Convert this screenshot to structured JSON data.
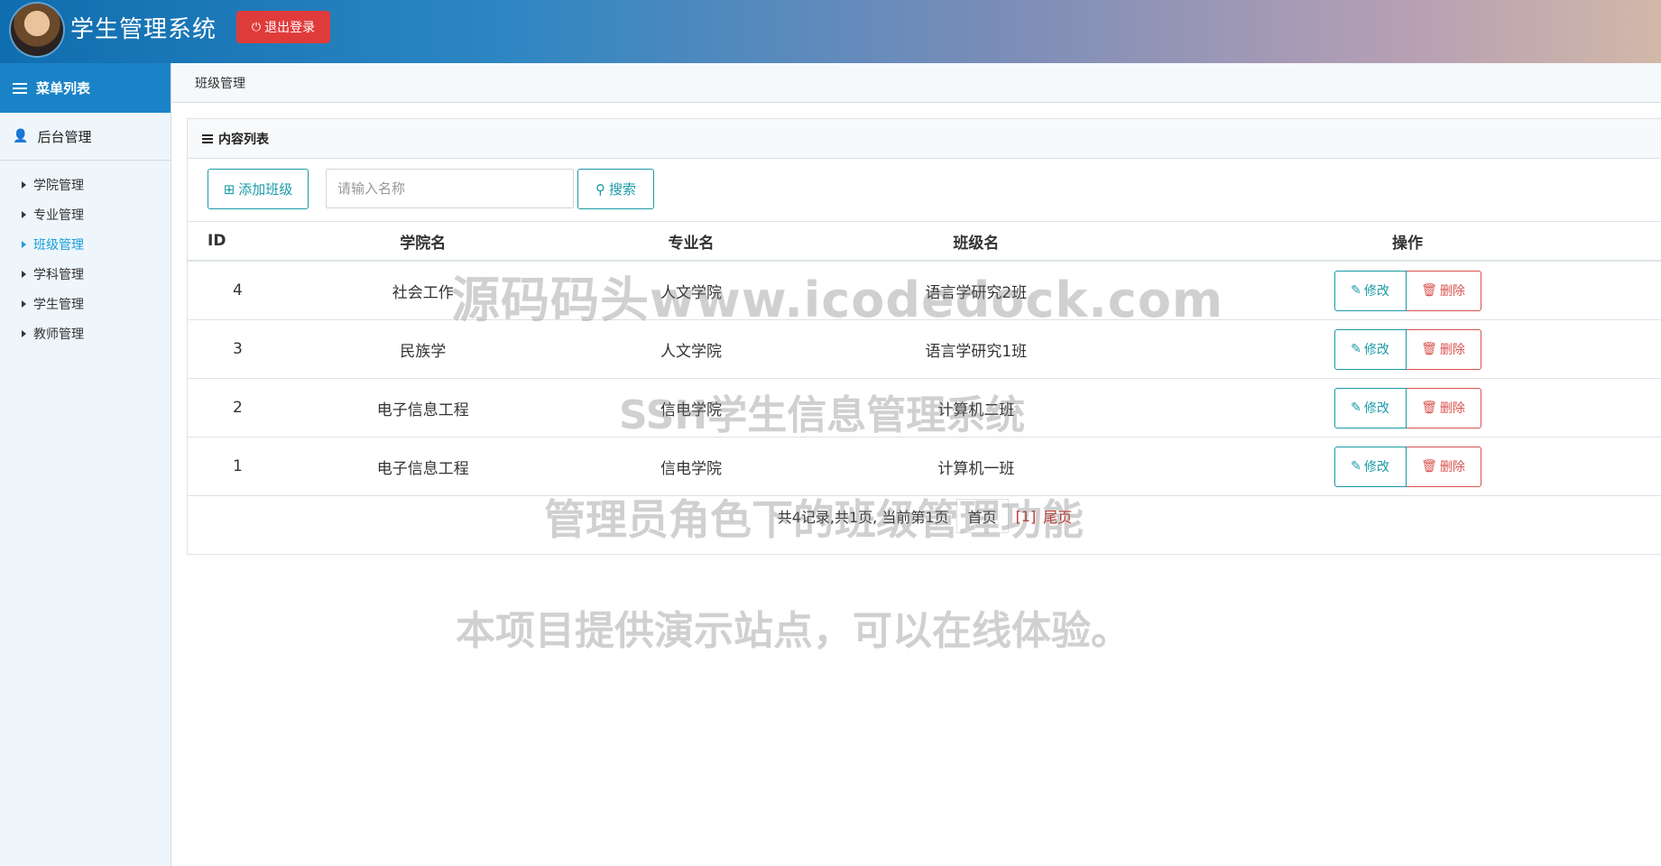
{
  "header": {
    "title": "学生管理系统",
    "logout_label": "退出登录"
  },
  "sidebar": {
    "menu_title": "菜单列表",
    "section_title": "后台管理",
    "items": [
      {
        "label": "学院管理"
      },
      {
        "label": "专业管理"
      },
      {
        "label": "班级管理",
        "active": true
      },
      {
        "label": "学科管理"
      },
      {
        "label": "学生管理"
      },
      {
        "label": "教师管理"
      }
    ]
  },
  "breadcrumb": "班级管理",
  "panel": {
    "title": "内容列表",
    "add_label": "添加班级",
    "search_placeholder": "请输入名称",
    "search_label": "搜索"
  },
  "table": {
    "headers": [
      "ID",
      "学院名",
      "专业名",
      "班级名",
      "操作"
    ],
    "rows": [
      {
        "id": "4",
        "college": "社会工作",
        "major": "人文学院",
        "class": "语言学研究2班"
      },
      {
        "id": "3",
        "college": "民族学",
        "major": "人文学院",
        "class": "语言学研究1班"
      },
      {
        "id": "2",
        "college": "电子信息工程",
        "major": "信电学院",
        "class": "计算机二班"
      },
      {
        "id": "1",
        "college": "电子信息工程",
        "major": "信电学院",
        "class": "计算机一班"
      }
    ],
    "edit_label": "修改",
    "delete_label": "删除"
  },
  "pagination": {
    "summary": "共4记录,共1页, 当前第1页",
    "first": "首页",
    "current": "[1]",
    "last": "尾页"
  },
  "watermark": {
    "line1": "源码码头www.icodedock.com",
    "line2": "SSH学生信息管理系统",
    "line3": "管理员角色下的班级管理功能",
    "line4": "本项目提供演示站点，可以在线体验。"
  },
  "colors": {
    "accent": "#1a9aa8",
    "danger": "#d9534f",
    "menu_head": "#1a83c7",
    "logout": "#e03b3b"
  }
}
